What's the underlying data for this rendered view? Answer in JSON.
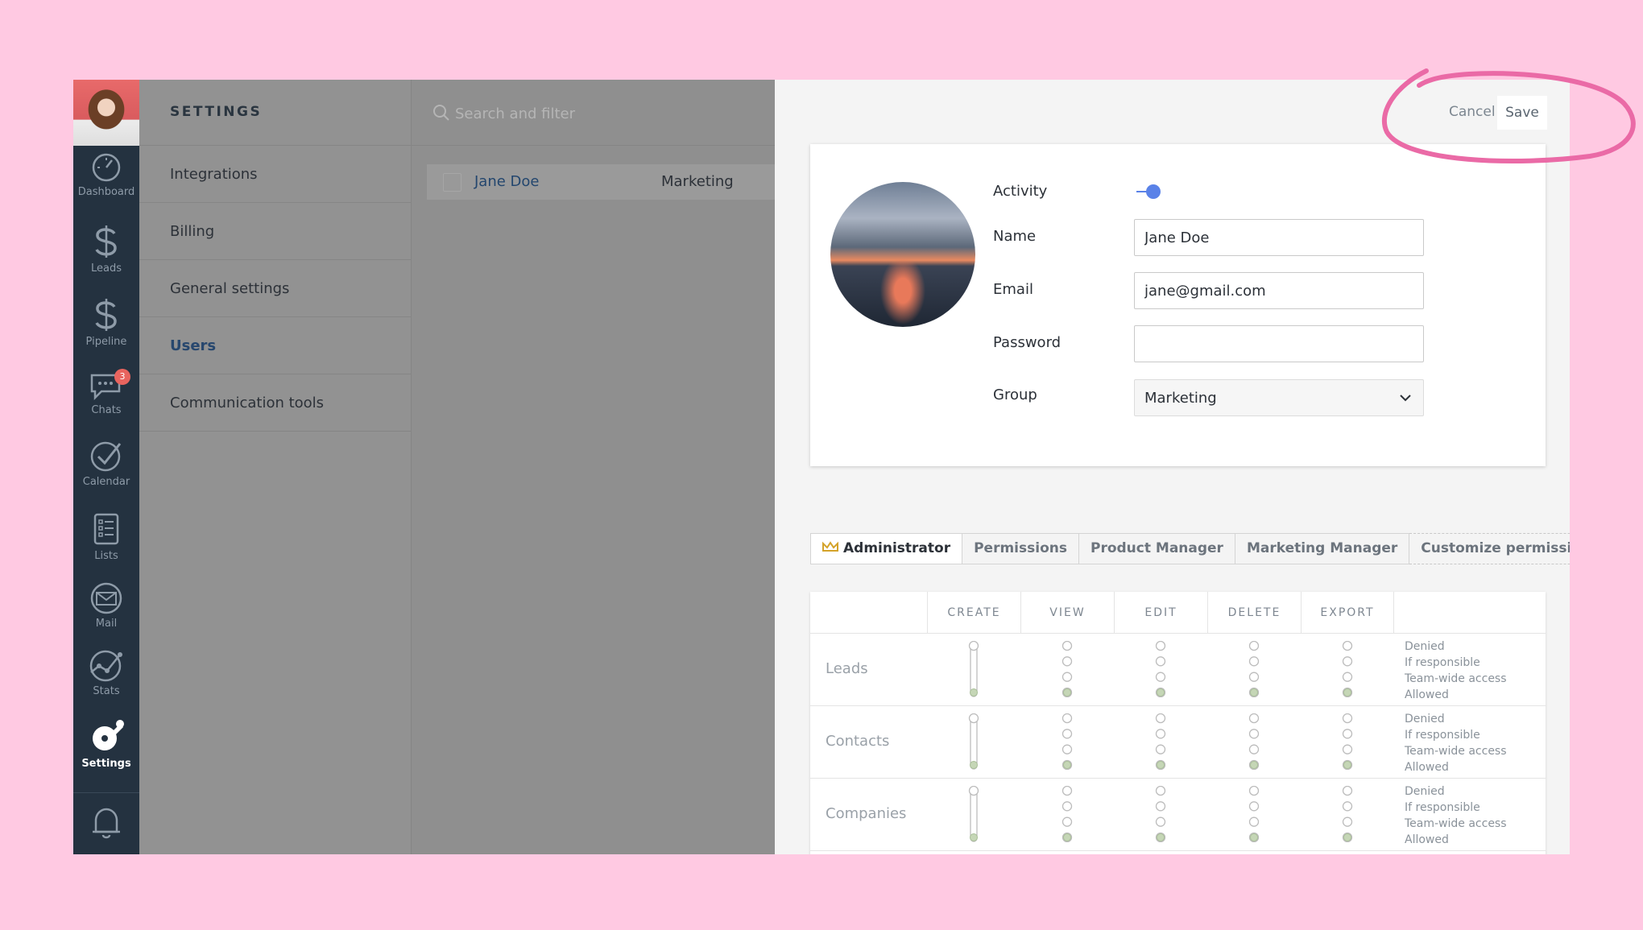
{
  "rail": {
    "items": [
      {
        "label": "Dashboard",
        "icon": "dashboard-icon"
      },
      {
        "label": "Leads",
        "icon": "dollar-icon"
      },
      {
        "label": "Pipeline",
        "icon": "dollar-icon"
      },
      {
        "label": "Chats",
        "icon": "chat-icon",
        "badge": "3"
      },
      {
        "label": "Calendar",
        "icon": "check-circle-icon"
      },
      {
        "label": "Lists",
        "icon": "list-icon"
      },
      {
        "label": "Mail",
        "icon": "mail-icon"
      },
      {
        "label": "Stats",
        "icon": "stats-icon"
      },
      {
        "label": "Settings",
        "icon": "wrench-icon"
      }
    ]
  },
  "settings": {
    "title": "SETTINGS",
    "menu": [
      {
        "label": "Integrations"
      },
      {
        "label": "Billing"
      },
      {
        "label": "General settings"
      },
      {
        "label": "Users",
        "active": true
      },
      {
        "label": "Communication tools"
      }
    ]
  },
  "users": {
    "search_placeholder": "Search and filter",
    "rows": [
      {
        "name": "Jane Doe",
        "group": "Marketing"
      }
    ]
  },
  "detail": {
    "cancel_label": "Cancel",
    "save_label": "Save",
    "activity_label": "Activity",
    "activity_on": true,
    "name_label": "Name",
    "name_value": "Jane Doe",
    "email_label": "Email",
    "email_value": "jane@gmail.com",
    "password_label": "Password",
    "password_value": "",
    "group_label": "Group",
    "group_value": "Marketing"
  },
  "roles": {
    "tabs": [
      "Administrator",
      "Permissions",
      "Product Manager",
      "Marketing Manager",
      "Customize permissions"
    ],
    "active": "Administrator"
  },
  "permissions": {
    "columns": [
      "CREATE",
      "VIEW",
      "EDIT",
      "DELETE",
      "EXPORT"
    ],
    "levels": [
      "Denied",
      "If responsible",
      "Team-wide access",
      "Allowed"
    ],
    "rows": [
      {
        "label": "Leads",
        "level": "Allowed"
      },
      {
        "label": "Contacts",
        "level": "Allowed"
      },
      {
        "label": "Companies",
        "level": "Allowed"
      }
    ]
  },
  "colors": {
    "accent": "#5a82e8",
    "rail_bg": "#243240",
    "highlight": "#ea6aa6",
    "page_bg": "#ffc9e2"
  }
}
